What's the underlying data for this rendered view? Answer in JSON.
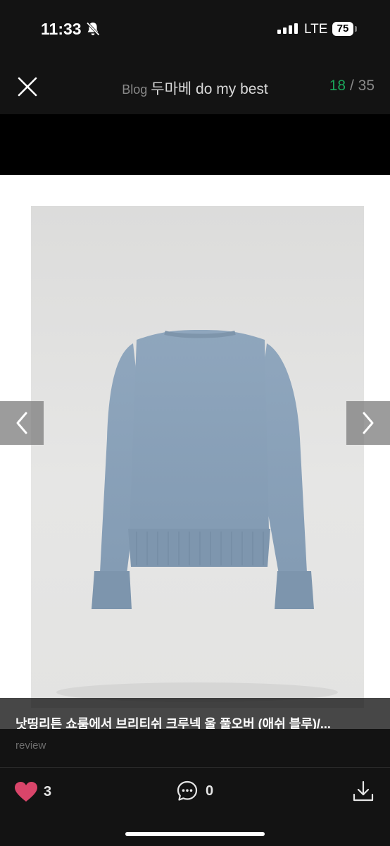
{
  "status_bar": {
    "time": "11:33",
    "network": "LTE",
    "battery": "75"
  },
  "header": {
    "prefix": "Blog",
    "title": "두마베 do my best",
    "current_index": "18",
    "separator": "/",
    "total": "35"
  },
  "photo": {
    "alt": "sweater"
  },
  "caption": {
    "title": "낫띵리튼 쇼룸에서 브리티쉬 크루넥 울 풀오버 (애쉬 블루)/...",
    "subtitle": "review"
  },
  "footer": {
    "likes": "3",
    "comments": "0"
  },
  "colors": {
    "accent_counter": "#1aa55a",
    "heart": "#d9456a",
    "sweater": "#93a9c0"
  },
  "icons": [
    "bell-slash-icon",
    "close-icon",
    "chevron-left-icon",
    "chevron-right-icon",
    "heart-icon",
    "comment-icon",
    "download-icon"
  ]
}
